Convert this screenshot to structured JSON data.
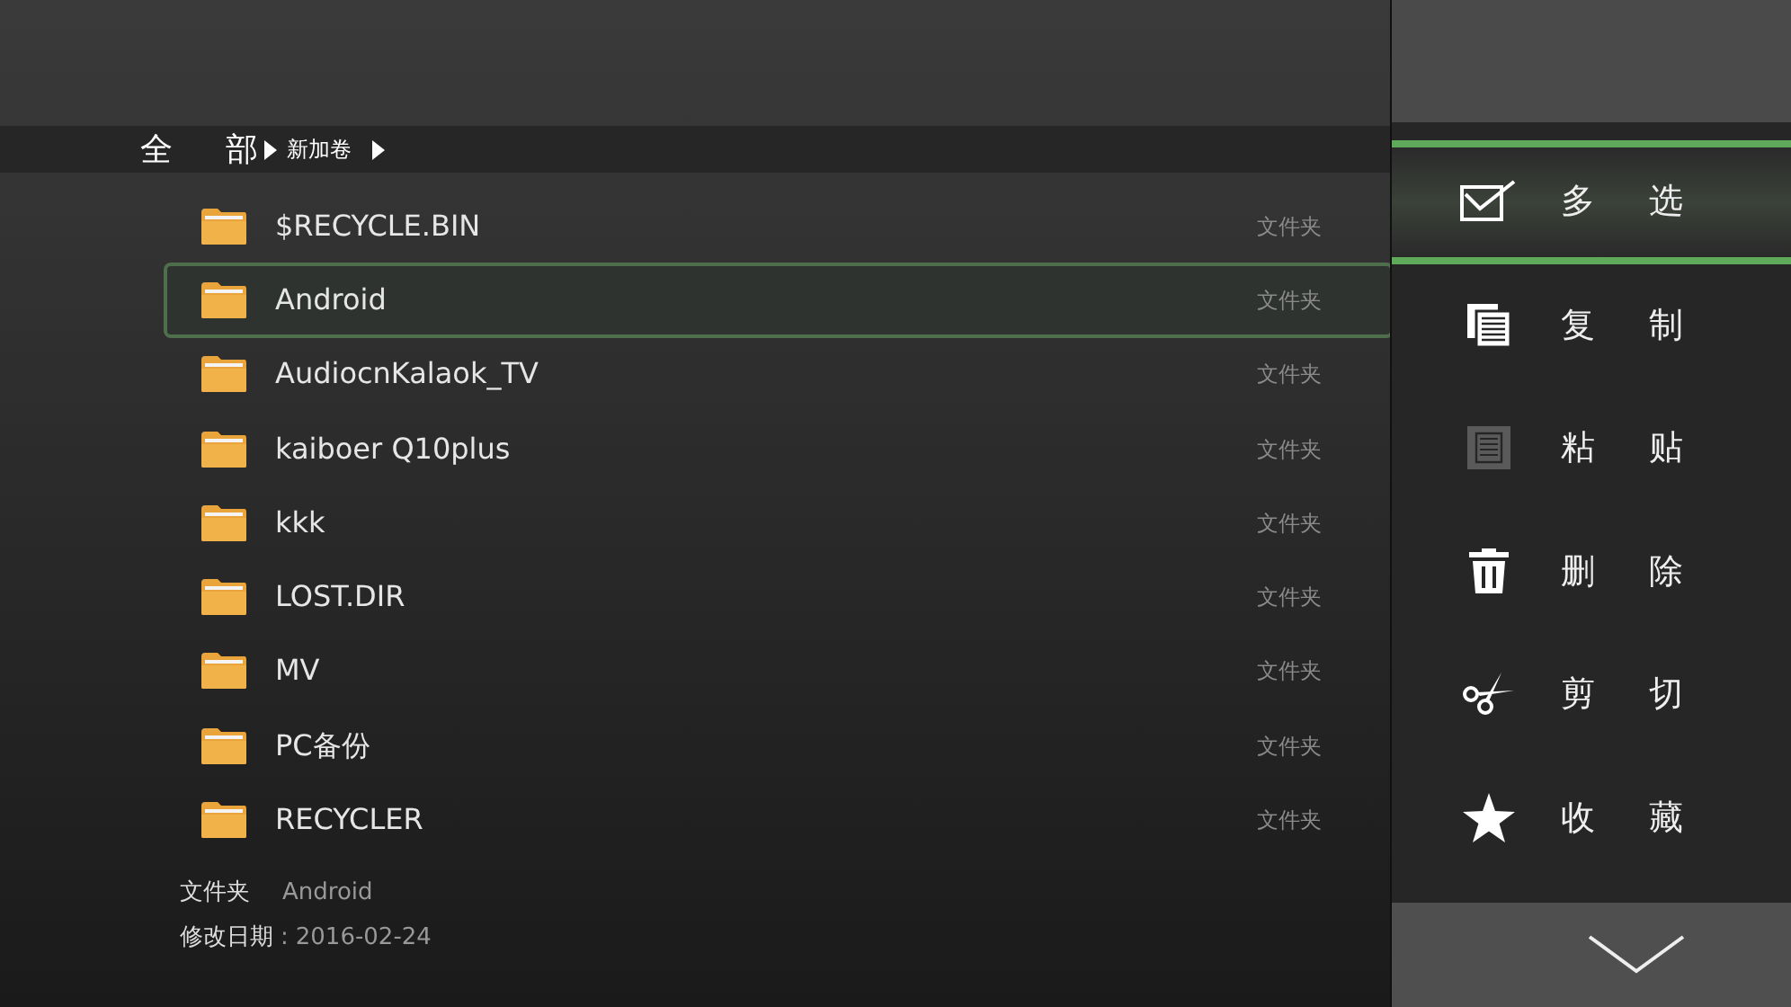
{
  "breadcrumb": {
    "root": "全 部",
    "path": [
      {
        "label": "新加卷"
      }
    ]
  },
  "files": [
    {
      "name": "$RECYCLE.BIN",
      "type": "文件夹",
      "selected": false
    },
    {
      "name": "Android",
      "type": "文件夹",
      "selected": true
    },
    {
      "name": "AudiocnKalaok_TV",
      "type": "文件夹",
      "selected": false
    },
    {
      "name": "kaiboer Q10plus",
      "type": "文件夹",
      "selected": false
    },
    {
      "name": "kkk",
      "type": "文件夹",
      "selected": false
    },
    {
      "name": "LOST.DIR",
      "type": "文件夹",
      "selected": false
    },
    {
      "name": "MV",
      "type": "文件夹",
      "selected": false
    },
    {
      "name": "PC备份",
      "type": "文件夹",
      "selected": false
    },
    {
      "name": "RECYCLER",
      "type": "文件夹",
      "selected": false
    }
  ],
  "details": {
    "type_label": "文件夹",
    "name": "Android",
    "date_label": "修改日期",
    "separator": ":",
    "date": "2016-02-24"
  },
  "menu": [
    {
      "kind": "multiselect",
      "label": "多 选",
      "selected": true,
      "disabled": false
    },
    {
      "kind": "copy",
      "label": "复 制",
      "selected": false,
      "disabled": false
    },
    {
      "kind": "paste",
      "label": "粘 贴",
      "selected": false,
      "disabled": true
    },
    {
      "kind": "delete",
      "label": "删 除",
      "selected": false,
      "disabled": false
    },
    {
      "kind": "cut",
      "label": "剪 切",
      "selected": false,
      "disabled": false
    },
    {
      "kind": "favorite",
      "label": "收 藏",
      "selected": false,
      "disabled": false
    }
  ]
}
